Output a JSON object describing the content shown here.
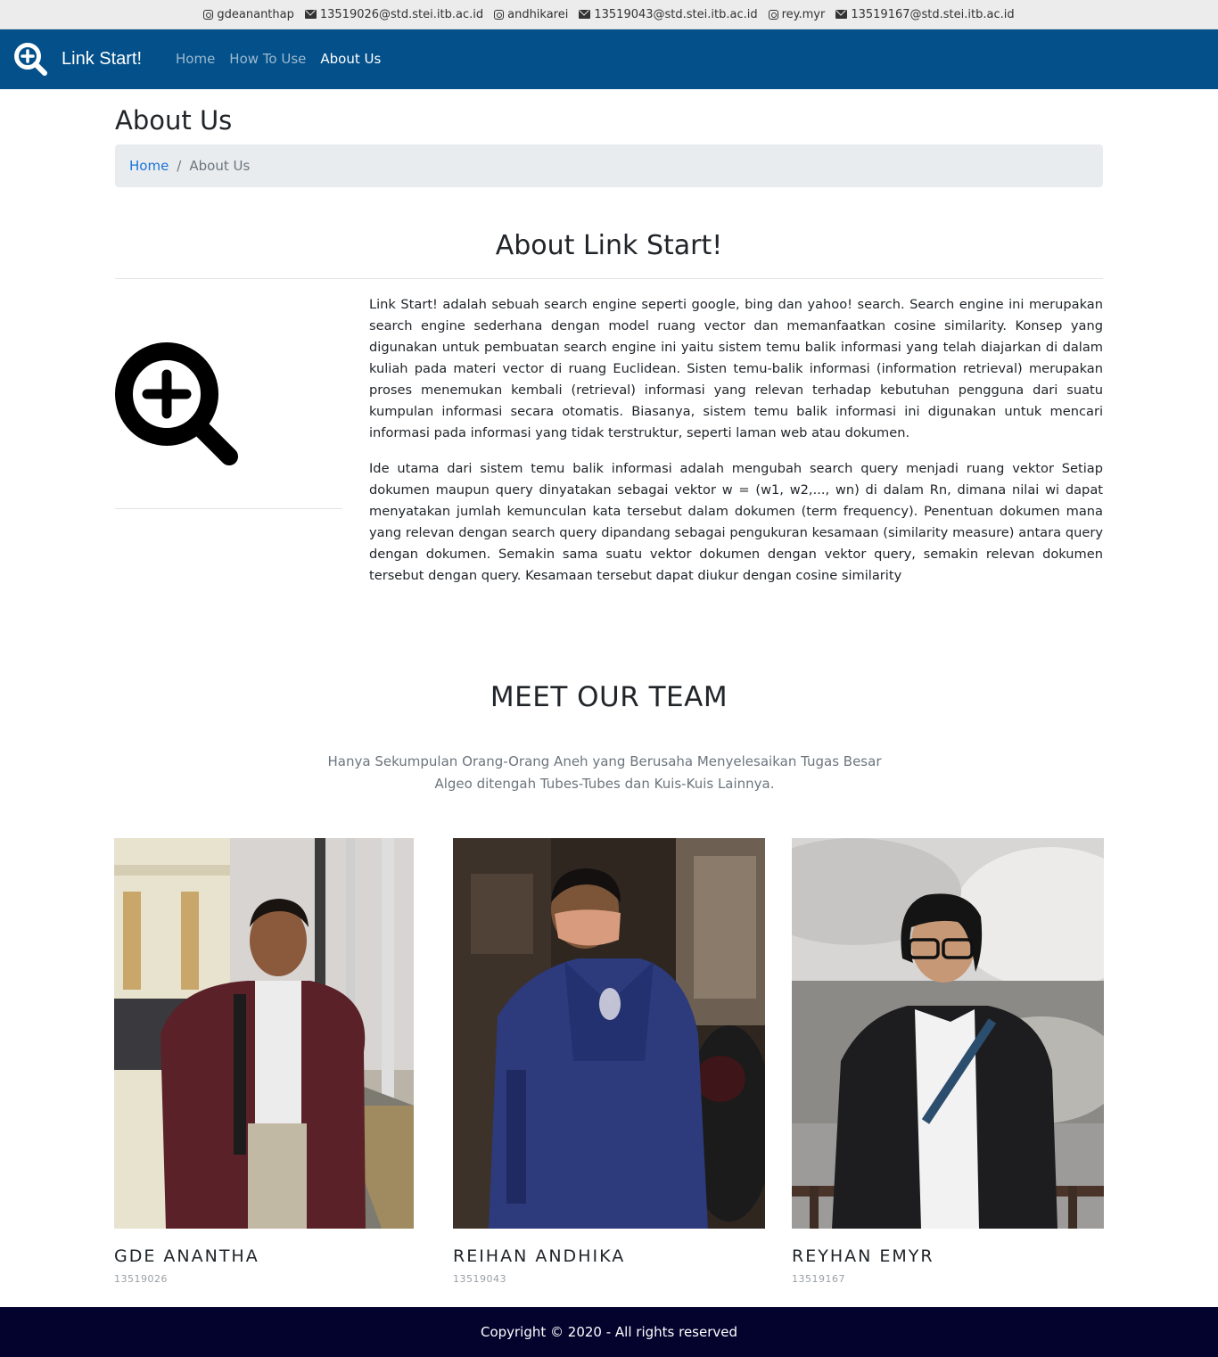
{
  "contacts": [
    {
      "type": "instagram",
      "icon": "instagram-icon",
      "text": "gdeananthap"
    },
    {
      "type": "email",
      "icon": "envelope-icon",
      "text": "13519026@std.stei.itb.ac.id"
    },
    {
      "type": "instagram",
      "icon": "instagram-icon",
      "text": "andhikarei"
    },
    {
      "type": "email",
      "icon": "envelope-icon",
      "text": "13519043@std.stei.itb.ac.id"
    },
    {
      "type": "instagram",
      "icon": "instagram-icon",
      "text": "rey.myr"
    },
    {
      "type": "email",
      "icon": "envelope-icon",
      "text": "13519167@std.stei.itb.ac.id"
    }
  ],
  "navbar": {
    "brand": "Link Start!",
    "brand_icon": "magnifier-plus-icon",
    "links": [
      {
        "label": "Home",
        "active": false
      },
      {
        "label": "How To Use",
        "active": false
      },
      {
        "label": "About Us",
        "active": true
      }
    ],
    "color": "#03508a"
  },
  "page": {
    "title": "About Us",
    "breadcrumb": {
      "home": "Home",
      "separator": "/",
      "current": "About Us"
    }
  },
  "about": {
    "heading": "About Link Start!",
    "paragraphs": [
      "Link Start! adalah sebuah search engine seperti google, bing dan yahoo! search. Search engine ini merupakan search engine sederhana dengan model ruang vector dan memanfaatkan cosine similarity. Konsep yang digunakan untuk pembuatan search engine ini yaitu sistem temu balik informasi yang telah diajarkan di dalam kuliah pada materi vector di ruang Euclidean. Sisten temu-balik informasi (information retrieval) merupakan proses menemukan kembali (retrieval) informasi yang relevan terhadap kebutuhan pengguna dari suatu kumpulan informasi secara otomatis. Biasanya, sistem temu balik informasi ini digunakan untuk mencari informasi pada informasi yang tidak terstruktur, seperti laman web atau dokumen.",
      "Ide utama dari sistem temu balik informasi adalah mengubah search query menjadi ruang vektor Setiap dokumen maupun query dinyatakan sebagai vektor w = (w1, w2,..., wn) di dalam Rn, dimana nilai wi dapat menyatakan jumlah kemunculan kata tersebut dalam dokumen (term frequency). Penentuan dokumen mana yang relevan dengan search query dipandang sebagai pengukuran kesamaan (similarity measure) antara query dengan dokumen. Semakin sama suatu vektor dokumen dengan vektor query, semakin relevan dokumen tersebut dengan query. Kesamaan tersebut dapat diukur dengan cosine similarity"
    ]
  },
  "team": {
    "heading": "MEET OUR TEAM",
    "subtitle": "Hanya Sekumpulan Orang-Orang Aneh yang Berusaha Menyelesaikan Tugas Besar Algeo ditengah Tubes-Tubes dan Kuis-Kuis Lainnya.",
    "members": [
      {
        "name": "GDE ANANTHA",
        "id": "13519026"
      },
      {
        "name": "REIHAN ANDHIKA",
        "id": "13519043"
      },
      {
        "name": "REYHAN EMYR",
        "id": "13519167"
      }
    ]
  },
  "footer": {
    "text": "Copyright © 2020 - All rights reserved",
    "color": "#03032e"
  }
}
